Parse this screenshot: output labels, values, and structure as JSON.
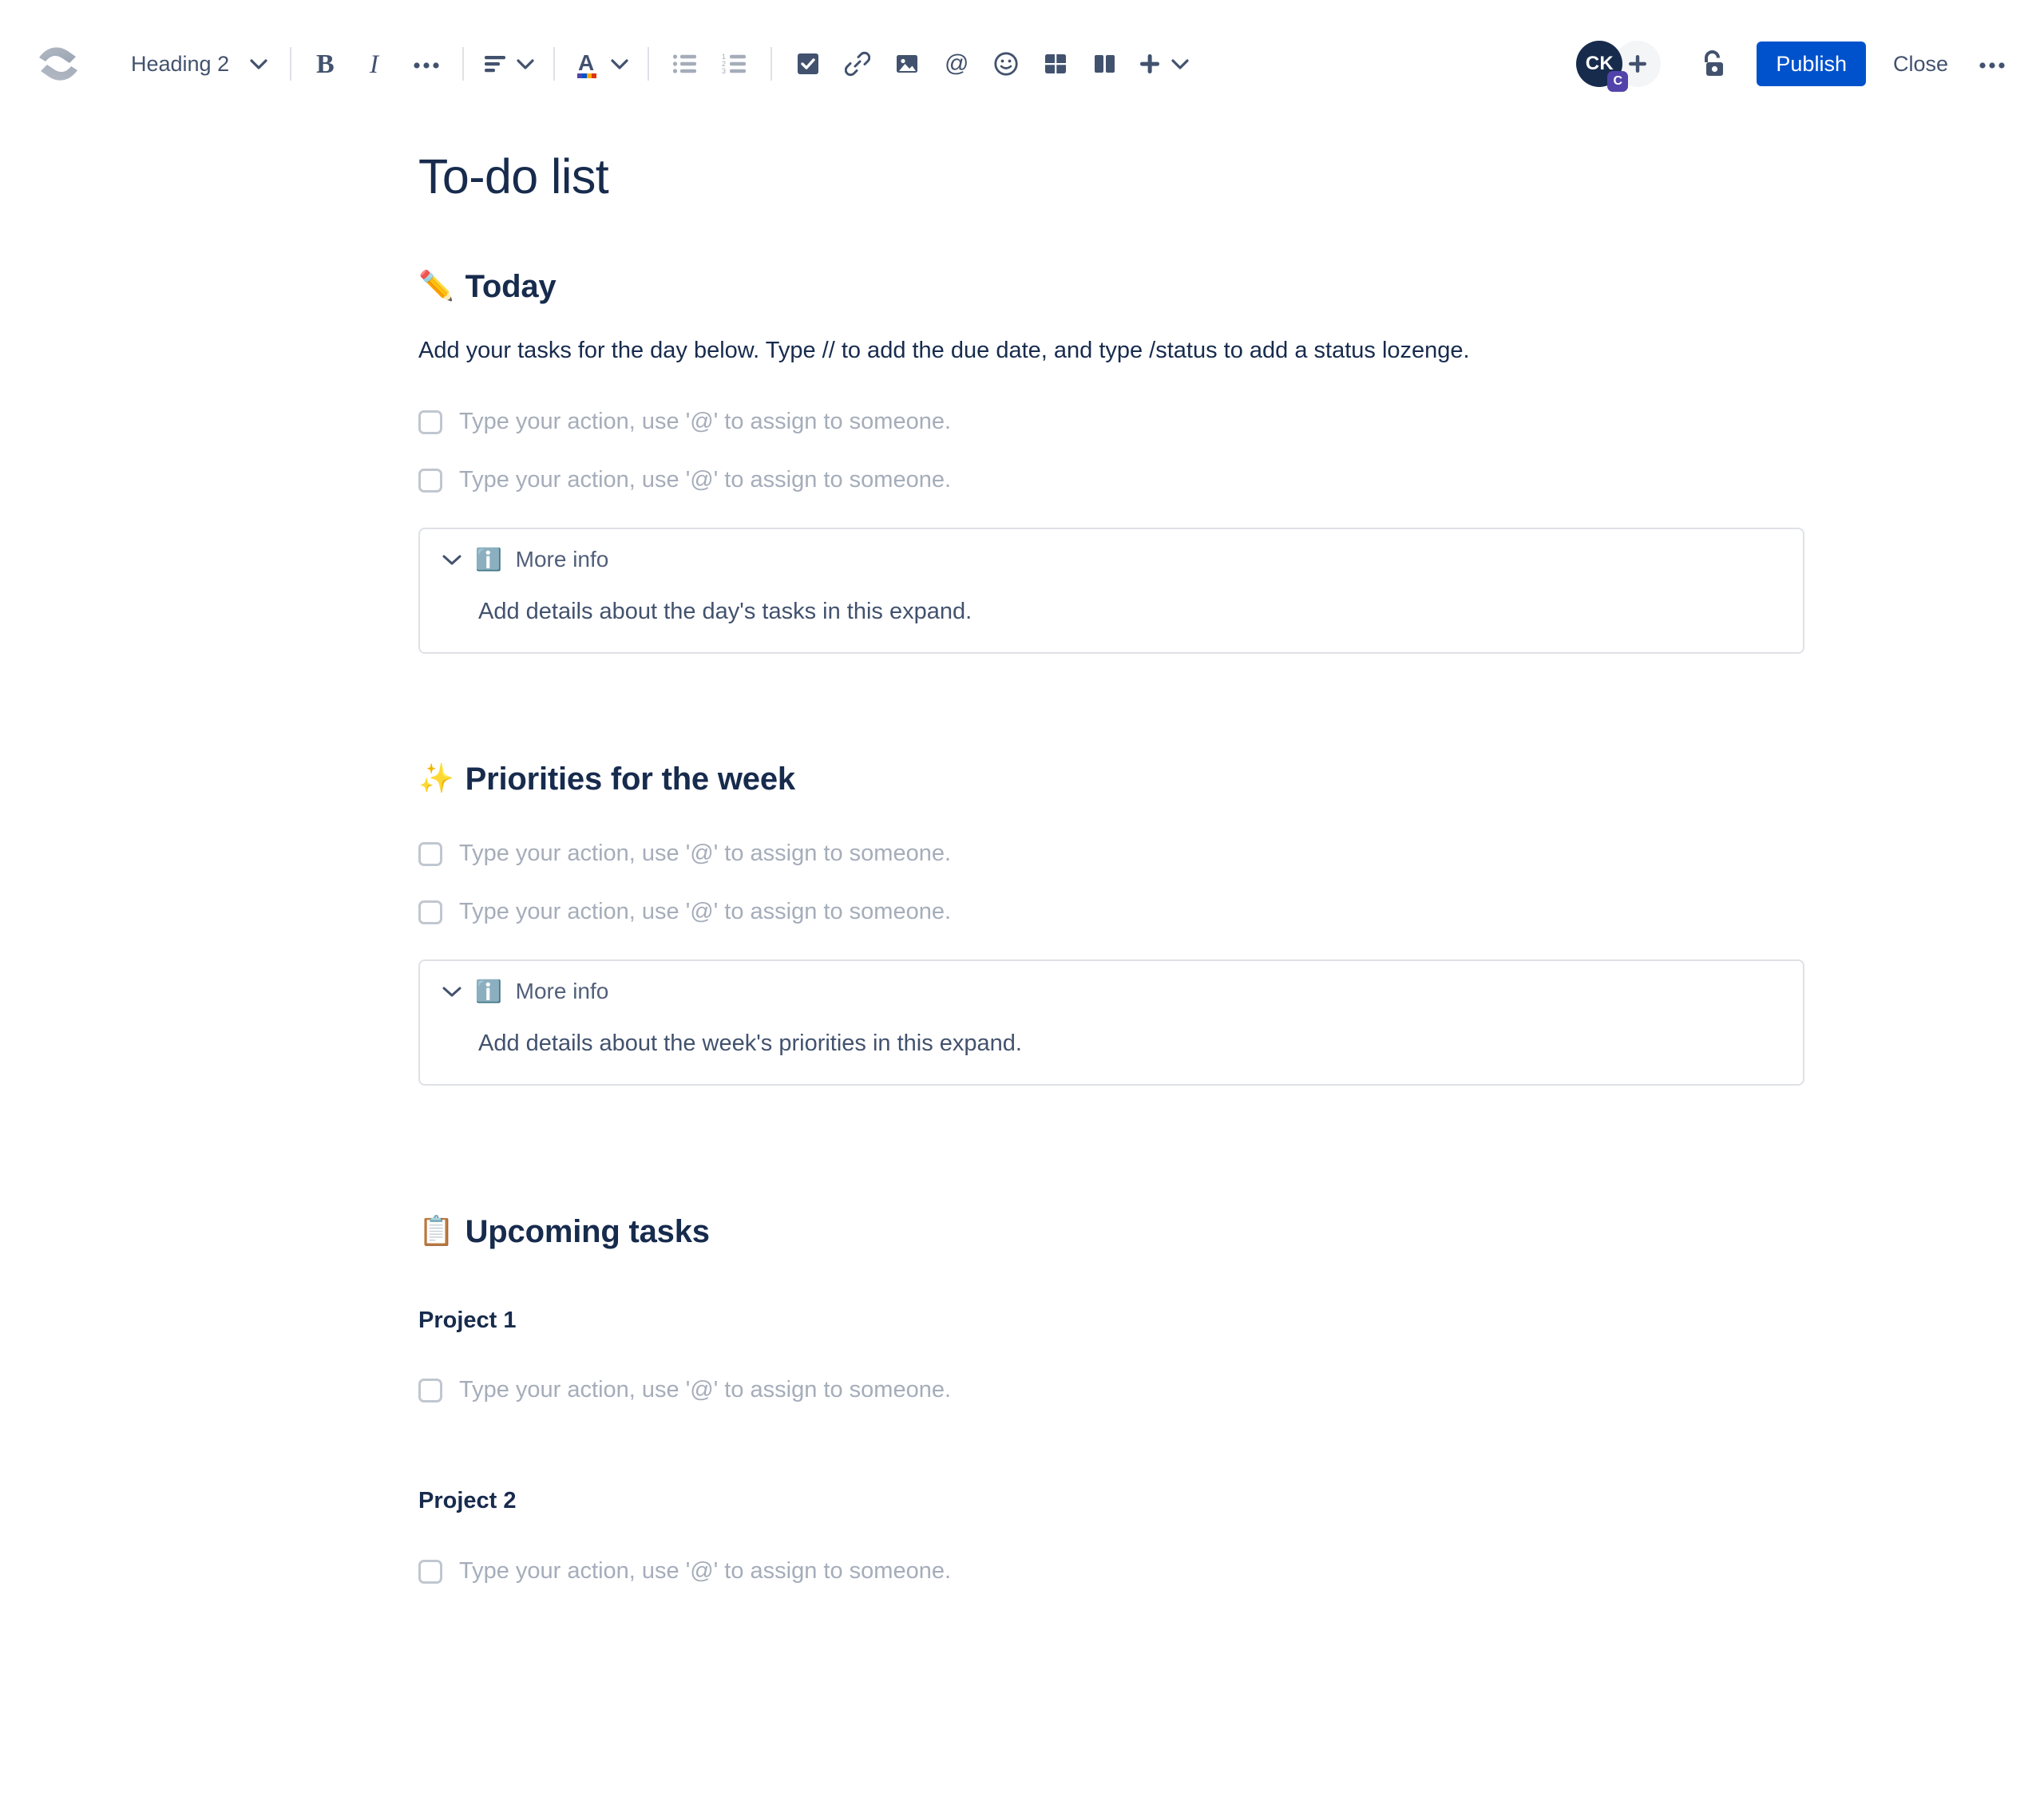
{
  "toolbar": {
    "logo_name": "confluence-logo",
    "style_select": {
      "label": "Heading 2"
    },
    "buttons": {
      "bold": "B",
      "italic": "I",
      "more_formatting": "•••",
      "text_align": "align-left",
      "text_color": "A",
      "bullet_list": "bulleted-list",
      "numbered_list": "numbered-list",
      "action_item": "checkbox",
      "link": "link",
      "image": "image",
      "mention": "@",
      "emoji": "emoji",
      "table": "table",
      "layout": "layout-columns",
      "insert_more": "+"
    },
    "avatar": {
      "initials": "CK",
      "badge": "C"
    },
    "add_people_label": "+",
    "restrictions_icon": "unlocked-padlock",
    "publish_label": "Publish",
    "close_label": "Close",
    "overflow_label": "•••"
  },
  "colors": {
    "primary_button": "#0052CC",
    "text_dark": "#172B4D",
    "text_muted": "#42526E",
    "placeholder": "#A5ADBA",
    "border": "#DFE1E6",
    "avatar_bg": "#172B4D",
    "avatar_badge_bg": "#5243AA"
  },
  "document": {
    "title": "To-do list",
    "sections": [
      {
        "emoji": "✏️",
        "emoji_name": "pencil-emoji",
        "heading": "Today",
        "intro": "Add your tasks for the day below. Type // to add the due date, and type /status to add a status lozenge.",
        "tasks": [
          "Type your action, use '@' to assign to someone.",
          "Type your action, use '@' to assign to someone."
        ],
        "expand": {
          "emoji": "ℹ️",
          "emoji_name": "information-emoji",
          "title": "More info",
          "body": "Add details about the day's tasks in this expand."
        }
      },
      {
        "emoji": "✨",
        "emoji_name": "sparkles-emoji",
        "heading": "Priorities for the week",
        "tasks": [
          "Type your action, use '@' to assign to someone.",
          "Type your action, use '@' to assign to someone."
        ],
        "expand": {
          "emoji": "📋",
          "emoji_name": "information-emoji",
          "title": "More info",
          "body": "Add details about the week's priorities in this expand."
        }
      },
      {
        "emoji": "📋",
        "emoji_name": "clipboard-emoji",
        "heading": "Upcoming tasks",
        "projects": [
          {
            "name": "Project 1",
            "tasks": [
              "Type your action, use '@' to assign to someone."
            ]
          },
          {
            "name": "Project 2",
            "tasks": [
              "Type your action, use '@' to assign to someone."
            ]
          }
        ]
      }
    ]
  }
}
